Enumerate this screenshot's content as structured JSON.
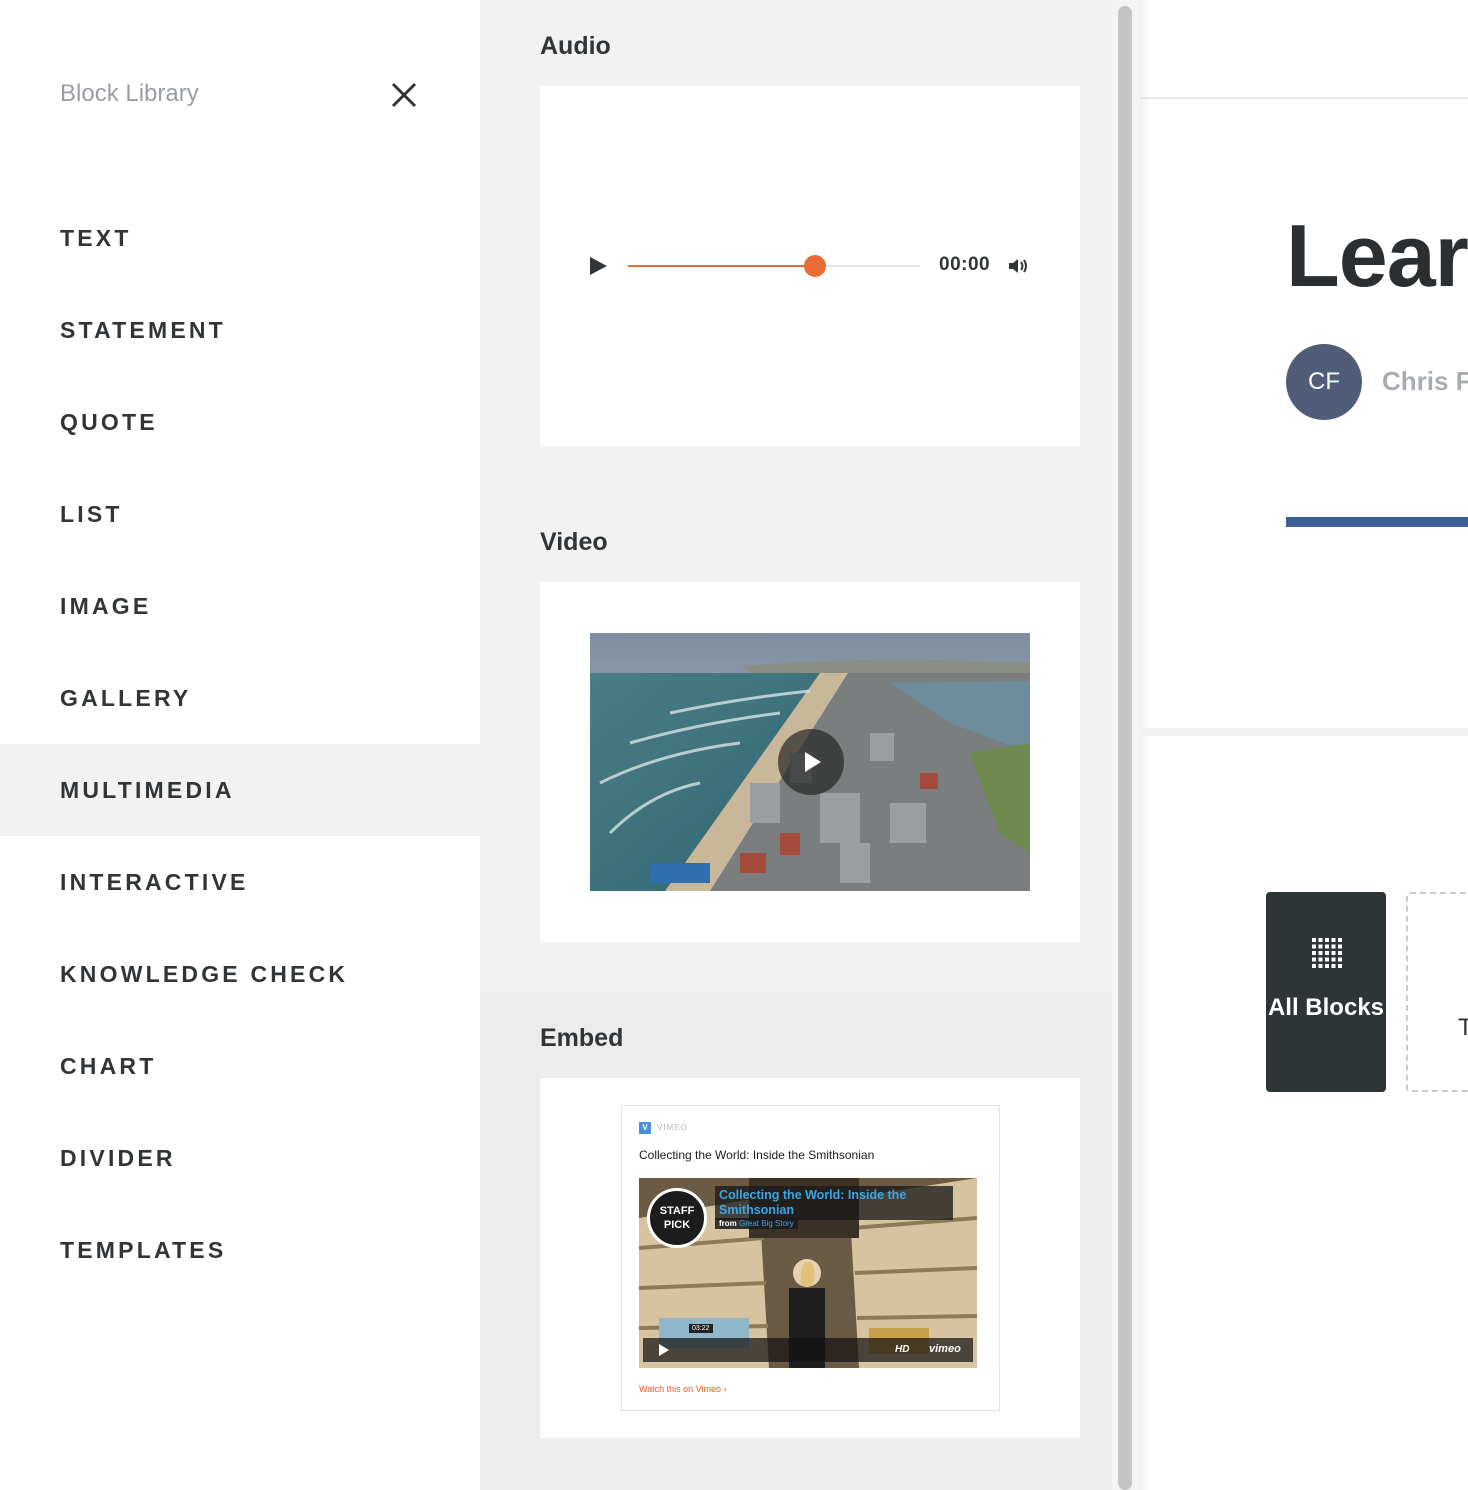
{
  "sidebar": {
    "title": "Block Library",
    "close_icon": "close-icon",
    "categories": [
      {
        "label": "TEXT",
        "active": false
      },
      {
        "label": "STATEMENT",
        "active": false
      },
      {
        "label": "QUOTE",
        "active": false
      },
      {
        "label": "LIST",
        "active": false
      },
      {
        "label": "IMAGE",
        "active": false
      },
      {
        "label": "GALLERY",
        "active": false
      },
      {
        "label": "MULTIMEDIA",
        "active": true
      },
      {
        "label": "INTERACTIVE",
        "active": false
      },
      {
        "label": "KNOWLEDGE CHECK",
        "active": false
      },
      {
        "label": "CHART",
        "active": false
      },
      {
        "label": "DIVIDER",
        "active": false
      },
      {
        "label": "TEMPLATES",
        "active": false
      }
    ]
  },
  "preview": {
    "audio": {
      "title": "Audio",
      "time": "00:00",
      "progress": 0.64,
      "accent_color": "#e86c35",
      "play_icon": "play-icon",
      "volume_icon": "volume-icon"
    },
    "video": {
      "title": "Video",
      "play_icon": "play-icon"
    },
    "embed": {
      "title": "Embed",
      "provider": "VIMEO",
      "provider_badge": "V",
      "video_title": "Collecting the World: Inside the Smithsonian",
      "overlay_title": "Collecting the World: Inside the Smithsonian",
      "from_prefix": "from",
      "from_channel": "Great Big Story",
      "staff_pick": "STAFF PICK",
      "duration": "03:22",
      "hd_label": "HD",
      "vimeo_logo": "vimeo",
      "watch_link": "Watch this on Vimeo",
      "link_color": "#e85d24"
    }
  },
  "lesson": {
    "title": "Learn",
    "avatar_initials": "CF",
    "author": "Chris Fo",
    "accent_color": "#3d5f97",
    "all_blocks_label": "All Blocks",
    "grid_icon": "grid-icon",
    "templates_label_partial": "T"
  }
}
